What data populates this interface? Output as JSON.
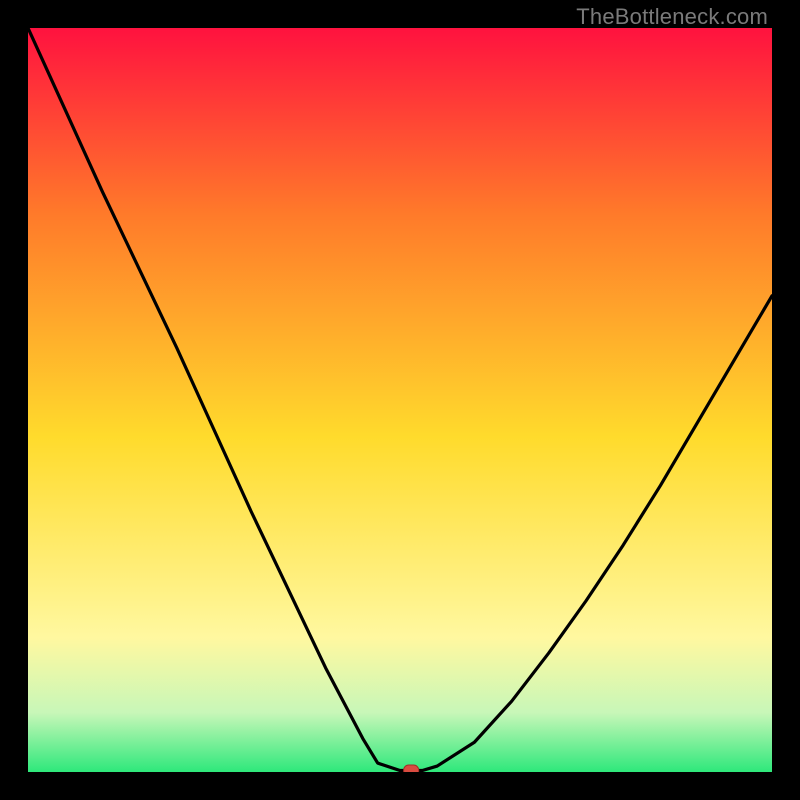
{
  "watermark": "TheBottleneck.com",
  "colors": {
    "background_black": "#000000",
    "gradient_top": "#ff123f",
    "gradient_mid_upper": "#ff7a2a",
    "gradient_mid": "#ffdb2c",
    "gradient_mid_lower": "#fff8a0",
    "gradient_low": "#c8f7b8",
    "gradient_bottom": "#2ee87b",
    "curve": "#000000",
    "marker_fill": "#d94b40",
    "marker_stroke": "#a32f27",
    "watermark_color": "#7a7a7a"
  },
  "chart_data": {
    "type": "line",
    "title": "",
    "xlabel": "",
    "ylabel": "",
    "xlim": [
      0,
      100
    ],
    "ylim": [
      0,
      100
    ],
    "grid": false,
    "legend": false,
    "x": [
      0,
      5,
      10,
      15,
      20,
      25,
      30,
      35,
      40,
      45,
      47,
      50,
      51.5,
      53,
      55,
      60,
      65,
      70,
      75,
      80,
      85,
      90,
      95,
      100
    ],
    "y": [
      100,
      89,
      78,
      67.5,
      57,
      46,
      35,
      24.5,
      14,
      4.5,
      1.2,
      0.2,
      0.2,
      0.2,
      0.8,
      4,
      9.5,
      16,
      23,
      30.5,
      38.5,
      47,
      55.5,
      64
    ],
    "marker": {
      "x": 51.5,
      "y": 0.2
    },
    "note": "x,y normalized 0–100; y=0 at bottom green band, y=100 at top red"
  }
}
